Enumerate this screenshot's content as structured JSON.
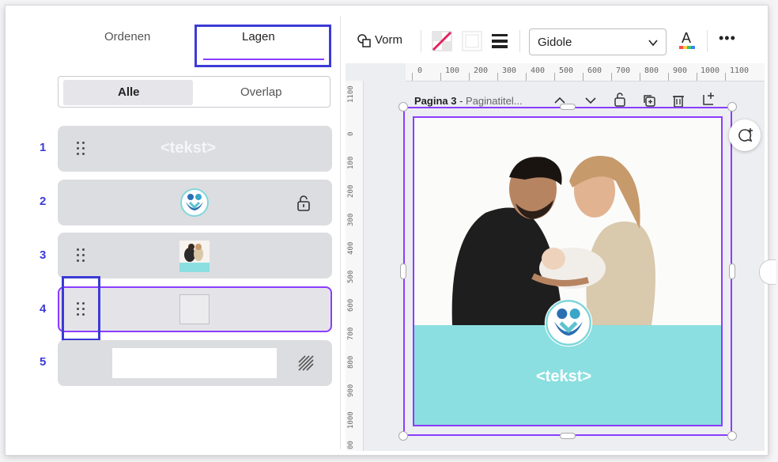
{
  "left_panel": {
    "tabs": [
      {
        "label": "Ordenen"
      },
      {
        "label": "Lagen"
      }
    ],
    "filter": {
      "all": "Alle",
      "overlap": "Overlap"
    },
    "layers": [
      {
        "number": "1",
        "text": "<tekst>"
      },
      {
        "number": "2"
      },
      {
        "number": "3"
      },
      {
        "number": "4"
      },
      {
        "number": "5"
      }
    ]
  },
  "toolbar": {
    "shape_label": "Vorm",
    "font_name": "Gidole",
    "more_label": "•••"
  },
  "ruler": {
    "h_ticks": [
      "0",
      "100",
      "200",
      "300",
      "400",
      "500",
      "600",
      "700",
      "800",
      "900",
      "1000",
      "1100"
    ],
    "v_ticks": [
      "1100",
      "0",
      "100",
      "200",
      "300",
      "400",
      "500",
      "600",
      "700",
      "800",
      "900",
      "1000",
      "00"
    ]
  },
  "page": {
    "page_label": "Pagina 3",
    "title_sep": " - ",
    "title": "Paginatitel...",
    "text": "<tekst>"
  },
  "colors": {
    "accent": "#8b3dff",
    "highlight": "#3b3bd6",
    "teal": "#8bdfe0"
  }
}
